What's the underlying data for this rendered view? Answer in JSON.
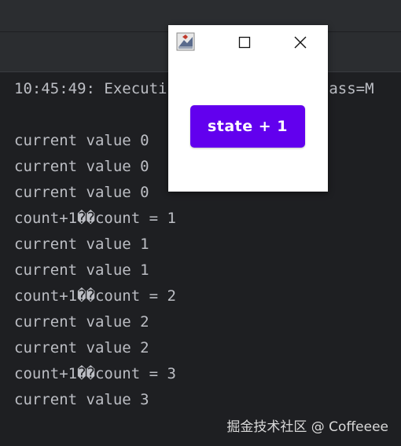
{
  "console": {
    "lines": [
      "10:45:49: Executi               nClass=M",
      "",
      "current value 0",
      "current value 0",
      "current value 0",
      "count+1��count = 1",
      "current value 1",
      "current value 1",
      "count+1��count = 2",
      "current value 2",
      "current value 2",
      "count+1��count = 3",
      "current value 3"
    ]
  },
  "watermark": {
    "text": "掘金技术社区 @ Coffeeee"
  },
  "popup": {
    "app_icon": "java-app-icon",
    "maximize_icon": "maximize-icon",
    "close_icon": "close-icon",
    "button_label": "state + 1",
    "button_color": "#6200ee"
  },
  "theme": {
    "background": "#1e1f22",
    "panel": "#2b2d30",
    "text": "#bcbec4"
  }
}
